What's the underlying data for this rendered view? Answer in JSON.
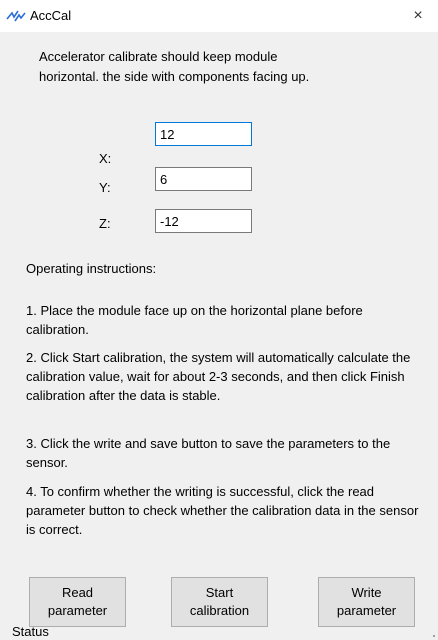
{
  "window": {
    "title": "AccCal",
    "close_label": "×"
  },
  "description": "Accelerator calibrate should keep module horizontal. the side with components facing up.",
  "fields": [
    {
      "label": "X:",
      "value": "12"
    },
    {
      "label": "Y:",
      "value": "6"
    },
    {
      "label": "Z:",
      "value": "-12"
    }
  ],
  "instructions": {
    "heading": "Operating instructions:",
    "steps": [
      "1. Place the module face up on the horizontal plane before calibration.",
      "2. Click Start calibration, the system will automatically calculate the calibration value, wait for about 2-3 seconds, and then click Finish calibration after the data is stable.",
      "3. Click the write and save button to save the parameters to the sensor.",
      "4. To confirm whether the writing is successful, click the read parameter button to check whether the calibration data in the sensor is correct."
    ]
  },
  "buttons": {
    "read": "Read parameter",
    "start": "Start calibration",
    "write": "Write parameter"
  },
  "status": "Status",
  "colors": {
    "window_bg": "#f0f0f0",
    "focus_accent": "#0078d7",
    "button_bg": "#e1e1e1"
  }
}
